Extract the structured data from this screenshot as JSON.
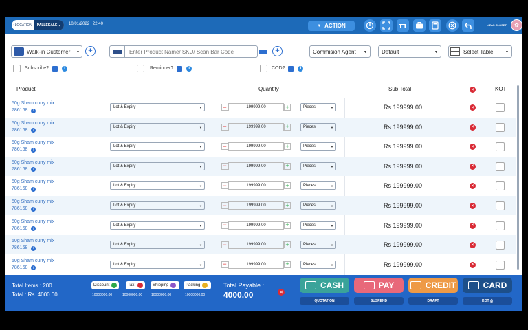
{
  "header": {
    "location_label": "LOCATION",
    "location_value": "PALLEKALE",
    "datetime": "10/01/2022 | 22:40",
    "action_label": "ACTION",
    "store_name": "LIZAS CLOSET"
  },
  "toolbar": {
    "customer_value": "Walk-in Customer",
    "scan_placeholder": "Enter Product Name/ SKU/ Scan Bar Code",
    "agent_value": "Commision Agent",
    "pricing_value": "Default",
    "table_value": "Select Table",
    "subscribe_label": "Subscribe?",
    "reminder_label": "Reminder?",
    "cod_label": "COD?"
  },
  "table": {
    "headers": {
      "product": "Product",
      "quantity": "Quantity",
      "subtotal": "Sub Total",
      "kot": "KOT"
    },
    "rows": [
      {
        "name": "50g Sham curry mix",
        "sku": "786168",
        "lot": "Lot & Expiry",
        "qty": "199999.00",
        "unit": "Pieces",
        "subtotal": "Rs 199999.00"
      },
      {
        "name": "50g Sham curry mix",
        "sku": "786168",
        "lot": "Lot & Expiry",
        "qty": "199999.00",
        "unit": "Pieces",
        "subtotal": "Rs 199999.00"
      },
      {
        "name": "50g Sham curry mix",
        "sku": "786168",
        "lot": "Lot & Expiry",
        "qty": "199999.00",
        "unit": "Pieces",
        "subtotal": "Rs 199999.00"
      },
      {
        "name": "50g Sham curry mix",
        "sku": "786168",
        "lot": "Lot & Expiry",
        "qty": "199999.00",
        "unit": "Pieces",
        "subtotal": "Rs 199999.00"
      },
      {
        "name": "50g Sham curry mix",
        "sku": "786168",
        "lot": "Lot & Expiry",
        "qty": "199999.00",
        "unit": "Pieces",
        "subtotal": "Rs 199999.00"
      },
      {
        "name": "50g Sham curry mix",
        "sku": "786168",
        "lot": "Lot & Expiry",
        "qty": "199999.00",
        "unit": "Pieces",
        "subtotal": "Rs 199999.00"
      },
      {
        "name": "50g Sham curry mix",
        "sku": "786168",
        "lot": "Lot & Expiry",
        "qty": "199999.00",
        "unit": "Pieces",
        "subtotal": "Rs 199999.00"
      },
      {
        "name": "50g Sham curry mix",
        "sku": "786168",
        "lot": "Lot & Expiry",
        "qty": "199999.00",
        "unit": "Pieces",
        "subtotal": "Rs 199999.00"
      },
      {
        "name": "50g Sham curry mix",
        "sku": "786168",
        "lot": "Lot & Expiry",
        "qty": "199999.00",
        "unit": "Pieces",
        "subtotal": "Rs 199999.00"
      }
    ]
  },
  "footer": {
    "total_items": "Total Items : 200",
    "total_rs": "Total : Rs. 4000.00",
    "discount_label": "Discount",
    "discount_value": "10000000.00",
    "tax_label": "Tax",
    "tax_value": "10000000.00",
    "shipping_label": "Shipping",
    "shipping_value": "10000000.00",
    "packing_label": "Packing",
    "packing_value": "10000000.00",
    "payable_label": "Total Payable :",
    "payable_value": "4000.00",
    "cash_label": "CASH",
    "pay_label": "PAY",
    "credit_label": "CREDIT",
    "card_label": "CARD",
    "quotation_label": "QUOTATION",
    "suspend_label": "SUSPEND",
    "draft_label": "DRAFT",
    "kot_label": "KOT"
  },
  "colors": {
    "header_bg": "#1d6ab8",
    "footer_bg": "#2267c7",
    "cash": "#3aa39a",
    "pay": "#e8687a",
    "credit": "#ee9a46",
    "card": "#1d4f8a",
    "delete": "#d92b36"
  }
}
